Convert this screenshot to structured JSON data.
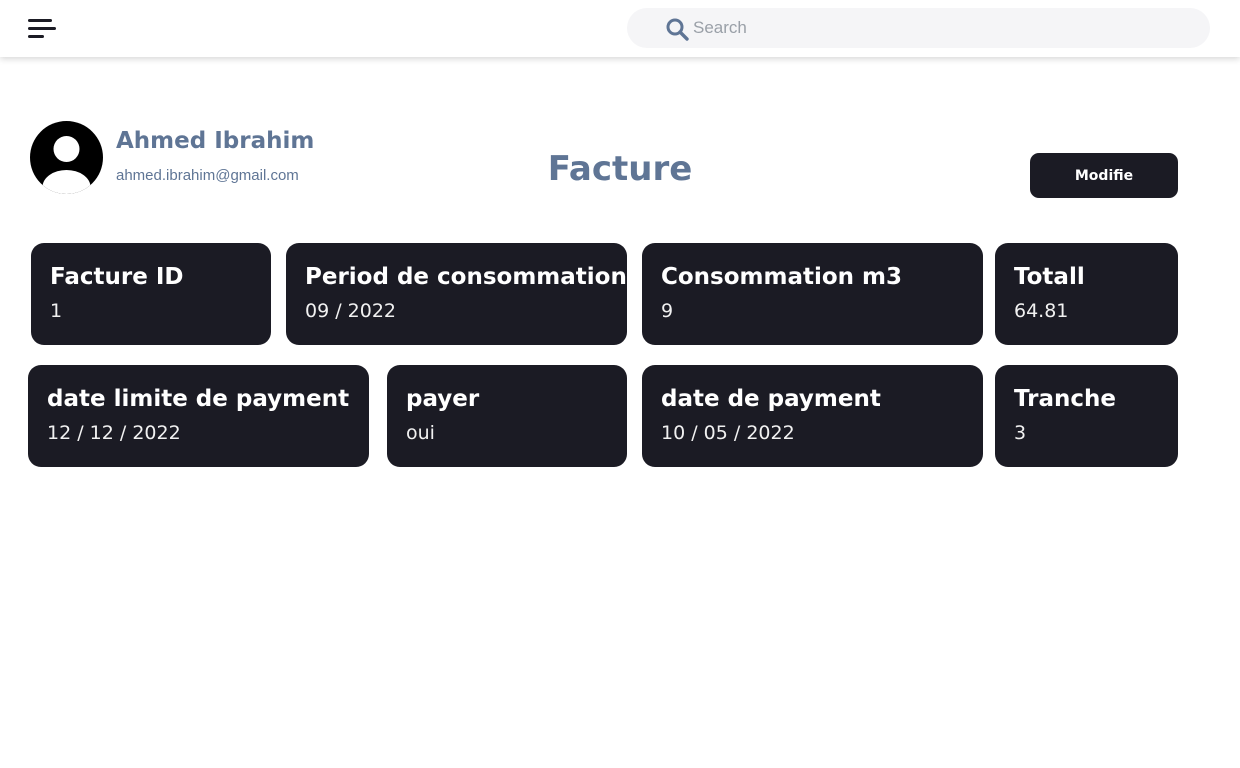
{
  "header": {
    "menu_icon": "hamburger-menu-icon",
    "search_icon": "search-icon",
    "search_placeholder": "Search",
    "search_value": ""
  },
  "profile": {
    "avatar_icon": "user-circle-icon",
    "name": "Ahmed Ibrahim",
    "email": "ahmed.ibrahim@gmail.com"
  },
  "page": {
    "title": "Facture",
    "modify_label": "Modifie"
  },
  "cards": [
    {
      "label": "Facture ID",
      "value": "1"
    },
    {
      "label": "Period de consommation",
      "value": "09 / 2022"
    },
    {
      "label": "Consommation m3",
      "value": "9"
    },
    {
      "label": "Totall",
      "value": "64.81"
    },
    {
      "label": "date limite de payment",
      "value": "12 / 12 / 2022"
    },
    {
      "label": "payer",
      "value": "oui"
    },
    {
      "label": "date de payment",
      "value": "10 / 05 / 2022"
    },
    {
      "label": "Tranche",
      "value": "3"
    }
  ],
  "colors": {
    "accent": "#5f7595",
    "card_bg": "#1b1b24",
    "search_bg": "#f5f5f7"
  }
}
